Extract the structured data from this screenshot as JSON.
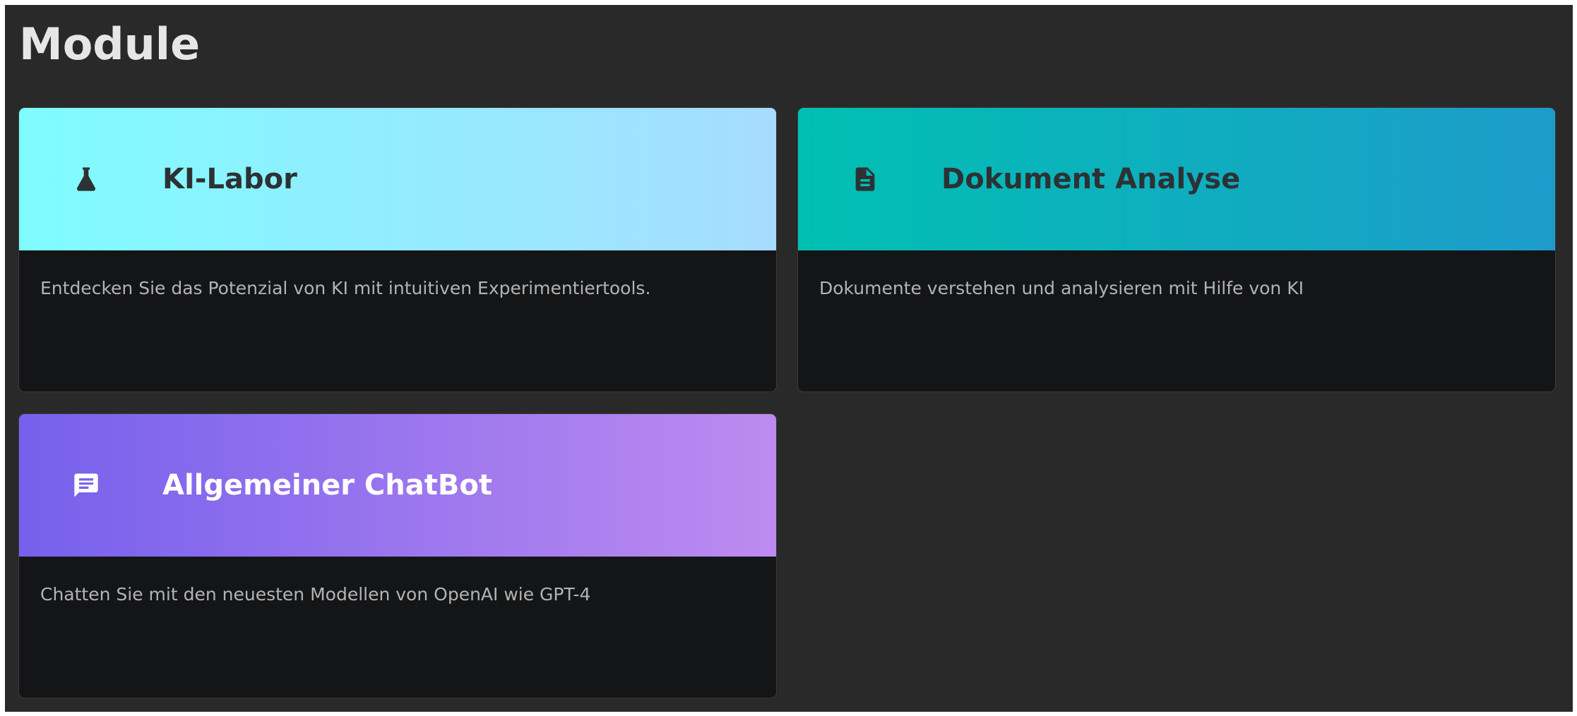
{
  "page": {
    "title": "Module"
  },
  "colors": {
    "background": "#292929",
    "card_body": "#141517",
    "text_dark": "#2c3234",
    "text_light": "#ffffff",
    "description": "#b3b3b3"
  },
  "modules": [
    {
      "title": "KI-Labor",
      "description": "Entdecken Sie das Potenzial von KI mit intuitiven Experimentiertools.",
      "icon": "flask-icon",
      "gradient": [
        "#7ffcff",
        "#a7dcff"
      ]
    },
    {
      "title": "Dokument Analyse",
      "description": "Dokumente verstehen und analysieren mit Hilfe von KI",
      "icon": "document-icon",
      "gradient": [
        "#00c0b2",
        "#1d9ccb"
      ]
    },
    {
      "title": "Allgemeiner ChatBot",
      "description": "Chatten Sie mit den neuesten Modellen von OpenAI wie GPT-4",
      "icon": "chat-icon",
      "gradient": [
        "#7660ec",
        "#bd8bf0"
      ]
    }
  ]
}
